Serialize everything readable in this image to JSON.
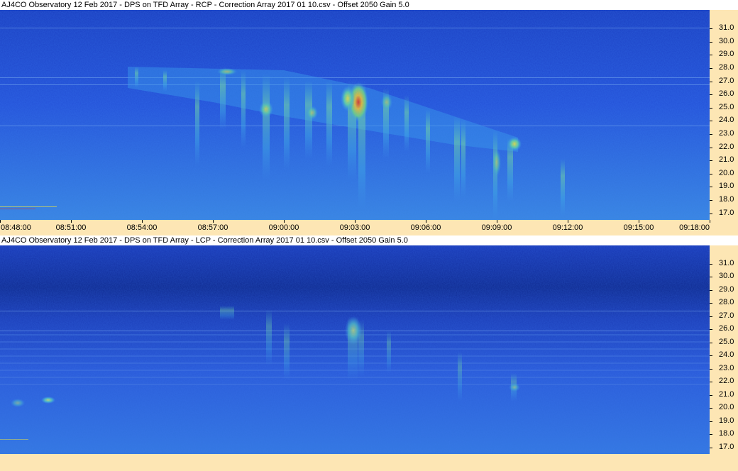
{
  "chart_data": [
    {
      "type": "heatmap",
      "title": "AJ4CO Observatory 12 Feb 2017  -  DPS on TFD Array  -  RCP  -  Correction Array 2017 01 10.csv  -  Offset 2050  Gain 5.0",
      "polarization": "RCP",
      "ylim": [
        16.5,
        32.4
      ],
      "yticks": [
        "31.0",
        "30.0",
        "29.0",
        "28.0",
        "27.0",
        "26.0",
        "25.0",
        "24.0",
        "23.0",
        "22.0",
        "21.0",
        "20.0",
        "19.0",
        "18.0",
        "17.0"
      ],
      "xlim": [
        "08:48:00",
        "09:18:00"
      ],
      "xticks": [
        "08:48:00",
        "08:51:00",
        "08:54:00",
        "08:57:00",
        "09:00:00",
        "09:03:00",
        "09:06:00",
        "09:09:00",
        "09:12:00",
        "09:15:00",
        "09:18:00"
      ],
      "colors": {
        "background": "#2050d8",
        "low": "#1a3fb8",
        "mid": "#3a9ee8",
        "high": "#e8e040",
        "peak": "#e03020"
      }
    },
    {
      "type": "heatmap",
      "title": "AJ4CO Observatory 12 Feb 2017  -  DPS on TFD Array  -  LCP  -  Correction Array 2017 01 10.csv  -  Offset 2050  Gain 5.0",
      "polarization": "LCP",
      "ylim": [
        16.5,
        32.4
      ],
      "yticks": [
        "31.0",
        "30.0",
        "29.0",
        "28.0",
        "27.0",
        "26.0",
        "25.0",
        "24.0",
        "23.0",
        "22.0",
        "21.0",
        "20.0",
        "19.0",
        "18.0",
        "17.0"
      ],
      "xlim": [
        "08:48:00",
        "09:18:00"
      ],
      "xticks": [],
      "colors": {
        "background": "#2050d8",
        "low": "#102a8c",
        "mid": "#3a9ee8",
        "high": "#c8e060"
      }
    }
  ]
}
